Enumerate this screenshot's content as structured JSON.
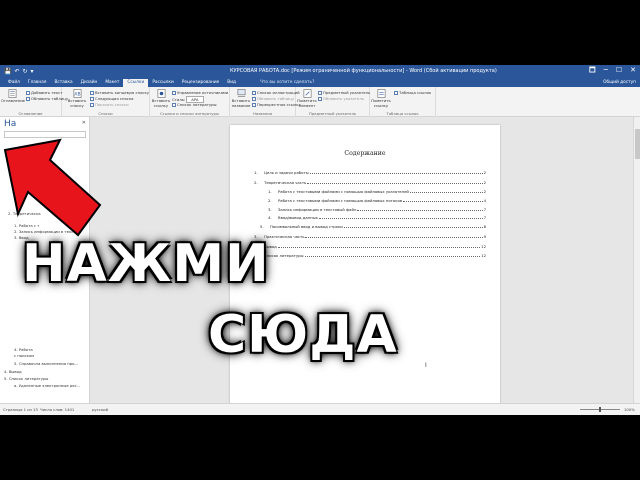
{
  "window": {
    "title": "КУРСОВАЯ РАБОТА.doc [Режим ограниченной функциональности] - Word (Сбой активации продукта)",
    "controls": [
      "🗖",
      "─",
      "☐",
      "✕"
    ]
  },
  "ribbon_tabs": [
    "Файл",
    "Главная",
    "Вставка",
    "Дизайн",
    "Макет",
    "Ссылки",
    "Рассылки",
    "Рецензирование",
    "Вид"
  ],
  "active_tab": "Ссылки",
  "tell_me": "Что вы хотите сделать?",
  "share": "Общий доступ",
  "ribbon": {
    "toc_button": "Оглавление",
    "add_text": "Добавить текст",
    "update_table": "Обновить таблицу",
    "group_toc": "Оглавление",
    "insert_footnote": "Вставить сноску",
    "insert_endnote": "Вставить концевую сноску",
    "next_footnote": "Следующая сноска",
    "show_notes": "Показать сноски",
    "group_footnotes": "Сноски",
    "insert_citation": "Вставить ссылку",
    "manage_sources": "Управление источниками",
    "style": "Стиль:",
    "style_value": "APA",
    "bibliography": "Список литературы",
    "group_citations": "Ссылки и списки литературы",
    "insert_caption": "Вставить название",
    "insert_table_of_figures": "Список иллюстраций",
    "update_table2": "Обновить таблицу",
    "cross_reference": "Перекрестная ссылка",
    "group_captions": "Названия",
    "mark_entry": "Пометить элемент",
    "insert_index": "Предметный указатель",
    "update_index": "Обновить указатель",
    "group_index": "Предметный указатель",
    "mark_citation": "Пометить ссылку",
    "table_of_authorities": "Таблица ссылок",
    "group_authorities": "Таблица ссылок"
  },
  "nav_pane": {
    "title": "На",
    "close": "✕",
    "items": [
      "открыть это",
      "2. Теоретическа",
      "1. Работа с т",
      "2. Запись информации в тексто...",
      "3. Ввод",
      "4. Работа",
      "с поиском",
      "5. Справочна выполнения про...",
      "4. Вывод",
      "5. Список литературы",
      "а. Удаленные электронные рес..."
    ]
  },
  "document": {
    "toc_title": "Содержание",
    "toc_entries": [
      {
        "num": "1.",
        "text": "Цель и задачи работы",
        "page": "2"
      },
      {
        "num": "2.",
        "text": "Теоретическая часть",
        "page": "2"
      },
      {
        "num": "1.",
        "text": "Работа с текстовыми файлами с помощью файловых указателей",
        "page": "2"
      },
      {
        "num": "2.",
        "text": "Работа с текстовыми файлами с помощью файловых потоков",
        "page": "4"
      },
      {
        "num": "3.",
        "text": "Запись информации в текстовый файл",
        "page": "7"
      },
      {
        "num": "4.",
        "text": "Ввод/вывод данных",
        "page": "7"
      },
      {
        "num": "5.",
        "text": "Посимвольный ввод и вывод строки",
        "page": "8"
      },
      {
        "num": "3.",
        "text": "Практическая часть",
        "page": "9"
      },
      {
        "num": "4.",
        "text": "Вывод",
        "page": "12"
      },
      {
        "num": "5.",
        "text": "Список литературы",
        "page": "12"
      }
    ]
  },
  "status": {
    "page": "Страница 1 из 13",
    "words": "Число слов: 1401",
    "language": "русский",
    "zoom": "100%",
    "zoom_level": 0.5
  },
  "overlay": {
    "line1": "НАЖМИ",
    "line2": "СЮДА",
    "arrow_color": "#e8141c"
  }
}
